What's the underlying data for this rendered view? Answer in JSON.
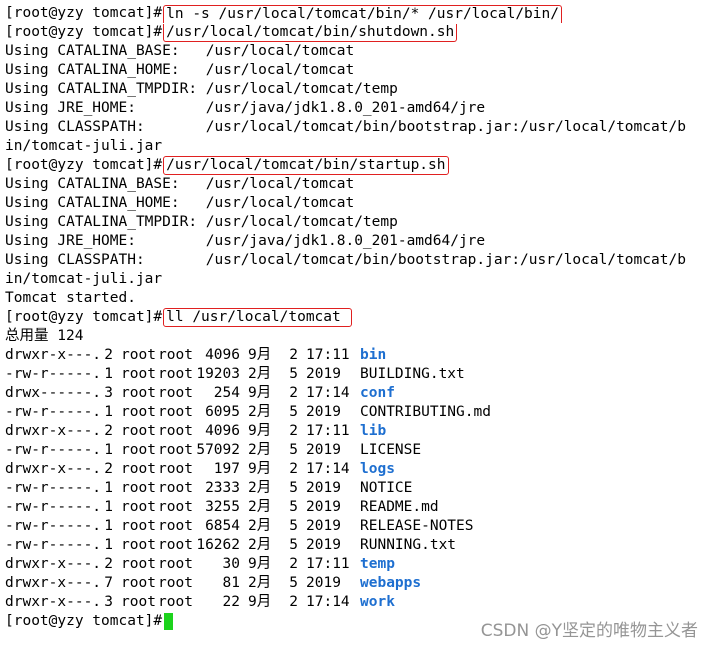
{
  "terminal": {
    "prompt": "[root@yzy tomcat]#",
    "cmd1_line1": "ln -s /usr/local/tomcat/bin/* /usr/local/bin/",
    "cmd1_line2": "/usr/local/tomcat/bin/shutdown.sh",
    "shutdown_output": [
      "Using CATALINA_BASE:   /usr/local/tomcat",
      "Using CATALINA_HOME:   /usr/local/tomcat",
      "Using CATALINA_TMPDIR: /usr/local/tomcat/temp",
      "Using JRE_HOME:        /usr/java/jdk1.8.0_201-amd64/jre",
      "Using CLASSPATH:       /usr/local/tomcat/bin/bootstrap.jar:/usr/local/tomcat/b",
      "in/tomcat-juli.jar"
    ],
    "cmd2": "/usr/local/tomcat/bin/startup.sh",
    "startup_output": [
      "Using CATALINA_BASE:   /usr/local/tomcat",
      "Using CATALINA_HOME:   /usr/local/tomcat",
      "Using CATALINA_TMPDIR: /usr/local/tomcat/temp",
      "Using JRE_HOME:        /usr/java/jdk1.8.0_201-amd64/jre",
      "Using CLASSPATH:       /usr/local/tomcat/bin/bootstrap.jar:/usr/local/tomcat/b",
      "in/tomcat-juli.jar",
      "Tomcat started."
    ],
    "cmd3": "ll /usr/local/tomcat",
    "total_line": "总用量 124",
    "listing": [
      {
        "perm": "drwxr-x---.",
        "links": "2",
        "owner": "root",
        "group": "root",
        "size": "4096",
        "month": "9月",
        "day": "2",
        "time": "17:11",
        "name": "bin",
        "is_dir": true
      },
      {
        "perm": "-rw-r-----.",
        "links": "1",
        "owner": "root",
        "group": "root",
        "size": "19203",
        "month": "2月",
        "day": "5",
        "time": "2019",
        "name": "BUILDING.txt",
        "is_dir": false
      },
      {
        "perm": "drwx------.",
        "links": "3",
        "owner": "root",
        "group": "root",
        "size": "254",
        "month": "9月",
        "day": "2",
        "time": "17:14",
        "name": "conf",
        "is_dir": true
      },
      {
        "perm": "-rw-r-----.",
        "links": "1",
        "owner": "root",
        "group": "root",
        "size": "6095",
        "month": "2月",
        "day": "5",
        "time": "2019",
        "name": "CONTRIBUTING.md",
        "is_dir": false
      },
      {
        "perm": "drwxr-x---.",
        "links": "2",
        "owner": "root",
        "group": "root",
        "size": "4096",
        "month": "9月",
        "day": "2",
        "time": "17:11",
        "name": "lib",
        "is_dir": true
      },
      {
        "perm": "-rw-r-----.",
        "links": "1",
        "owner": "root",
        "group": "root",
        "size": "57092",
        "month": "2月",
        "day": "5",
        "time": "2019",
        "name": "LICENSE",
        "is_dir": false
      },
      {
        "perm": "drwxr-x---.",
        "links": "2",
        "owner": "root",
        "group": "root",
        "size": "197",
        "month": "9月",
        "day": "2",
        "time": "17:14",
        "name": "logs",
        "is_dir": true
      },
      {
        "perm": "-rw-r-----.",
        "links": "1",
        "owner": "root",
        "group": "root",
        "size": "2333",
        "month": "2月",
        "day": "5",
        "time": "2019",
        "name": "NOTICE",
        "is_dir": false
      },
      {
        "perm": "-rw-r-----.",
        "links": "1",
        "owner": "root",
        "group": "root",
        "size": "3255",
        "month": "2月",
        "day": "5",
        "time": "2019",
        "name": "README.md",
        "is_dir": false
      },
      {
        "perm": "-rw-r-----.",
        "links": "1",
        "owner": "root",
        "group": "root",
        "size": "6854",
        "month": "2月",
        "day": "5",
        "time": "2019",
        "name": "RELEASE-NOTES",
        "is_dir": false
      },
      {
        "perm": "-rw-r-----.",
        "links": "1",
        "owner": "root",
        "group": "root",
        "size": "16262",
        "month": "2月",
        "day": "5",
        "time": "2019",
        "name": "RUNNING.txt",
        "is_dir": false
      },
      {
        "perm": "drwxr-x---.",
        "links": "2",
        "owner": "root",
        "group": "root",
        "size": "30",
        "month": "9月",
        "day": "2",
        "time": "17:11",
        "name": "temp",
        "is_dir": true
      },
      {
        "perm": "drwxr-x---.",
        "links": "7",
        "owner": "root",
        "group": "root",
        "size": "81",
        "month": "2月",
        "day": "5",
        "time": "2019",
        "name": "webapps",
        "is_dir": true
      },
      {
        "perm": "drwxr-x---.",
        "links": "3",
        "owner": "root",
        "group": "root",
        "size": "22",
        "month": "9月",
        "day": "2",
        "time": "17:14",
        "name": "work",
        "is_dir": true
      }
    ]
  },
  "watermark": "CSDN @Y坚定的唯物主义者",
  "colors": {
    "highlight_box": "#e02020",
    "directory": "#1e6fd0",
    "cursor": "#1cd31c"
  }
}
